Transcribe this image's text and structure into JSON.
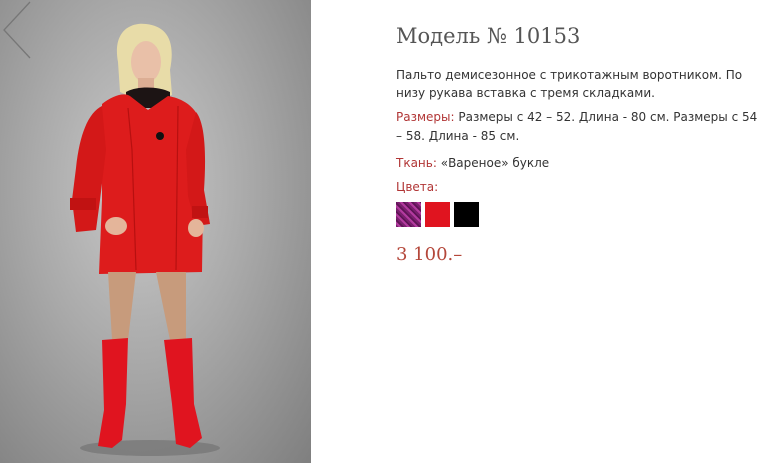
{
  "product": {
    "title": "Модель № 10153",
    "description": "Пальто демисезонное с трикотажным воротником. По низу рукава вставка с тремя складками.",
    "sizes_label": "Размеры:",
    "sizes_value": "Размеры с 42 – 52. Длина - 80 см. Размеры с 54 – 58. Длина - 85 см.",
    "fabric_label": "Ткань:",
    "fabric_value": "«Вареное» букле",
    "colors_label": "Цвета:",
    "colors": [
      {
        "name": "purple-swatch",
        "hex": "#8a2a7c"
      },
      {
        "name": "red-swatch",
        "hex": "#e0141f"
      },
      {
        "name": "black-swatch",
        "hex": "#000000"
      }
    ],
    "price": "3 100.–"
  },
  "gallery": {
    "prev_icon": "chevron-left-icon"
  },
  "theme": {
    "accent": "#b13535",
    "price_color": "#b4473a",
    "coat_color": "#e0141f"
  }
}
